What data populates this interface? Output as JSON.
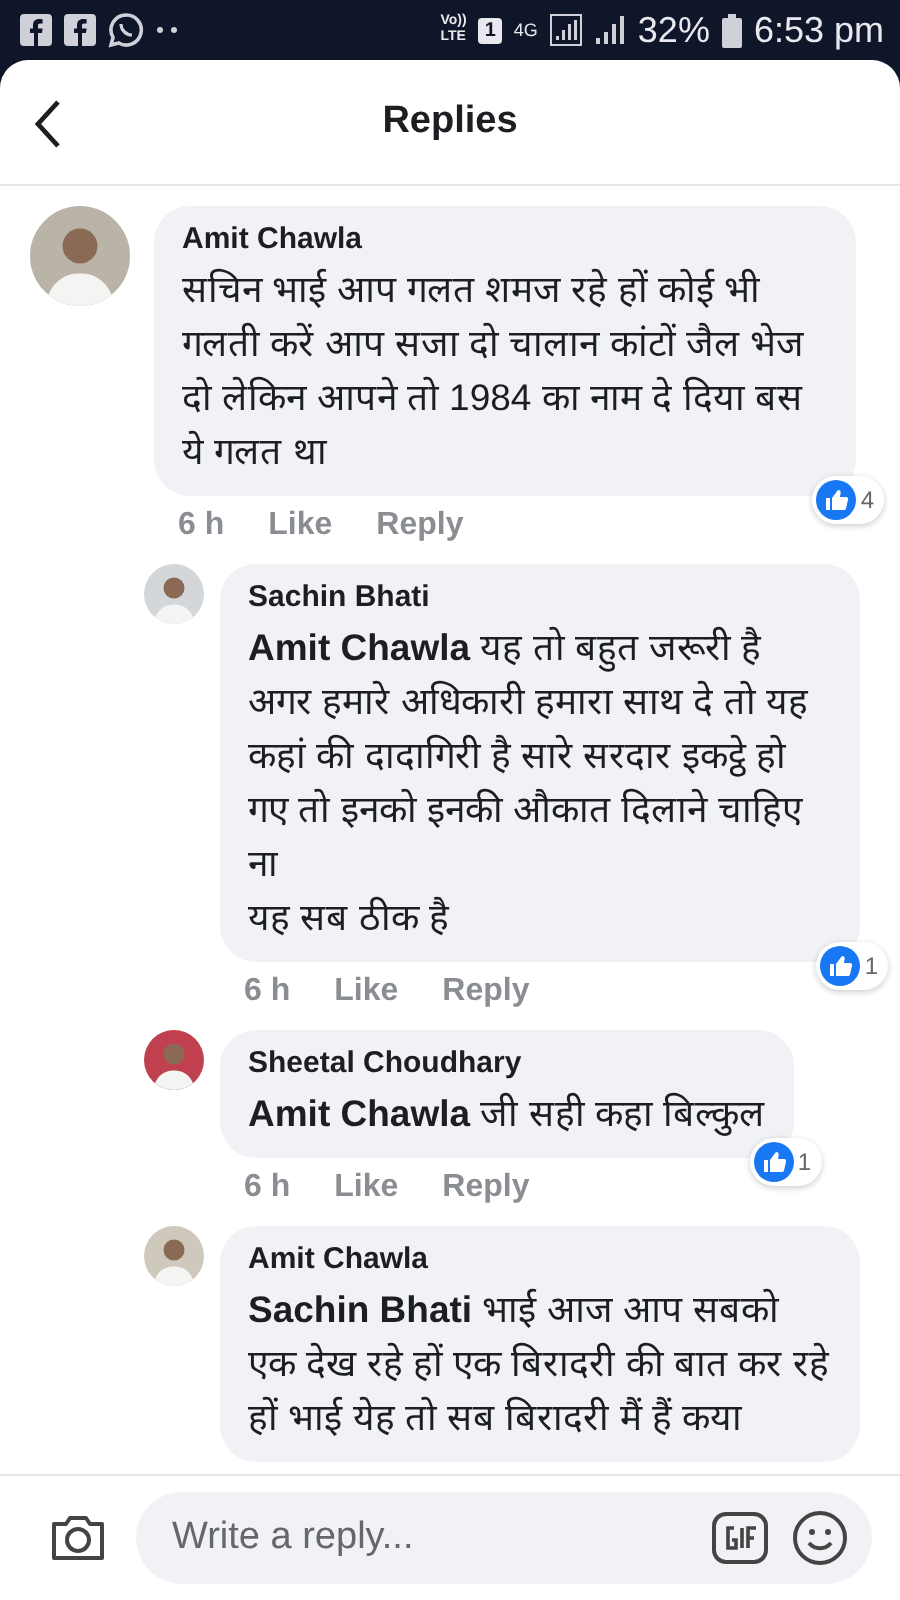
{
  "status_bar": {
    "volte": [
      "Vo))",
      "LTE"
    ],
    "sim": "1",
    "network": "4G",
    "battery": "32%",
    "time": "6:53 pm"
  },
  "header": {
    "title": "Replies"
  },
  "comments": [
    {
      "author": "Amit Chawla",
      "text": "सचिन  भाई  आप गलत शमज रहे हों कोई भी गलती करें आप सजा दो चालान कांटों जैल भेज दो लेकिन आपने तो 1984 का नाम दे दिया बस ये गलत था",
      "time": "6 h",
      "like": "Like",
      "reply": "Reply",
      "likes": "4",
      "children": [
        {
          "author": "Sachin Bhati",
          "text": "**Amit Chawla** यह तो बहुत जरूरी है अगर हमारे अधिकारी हमारा साथ दे तो यह कहां की दादागिरी है सारे सरदार इकट्ठे हो गए तो इनको इनकी औकात दिलाने चाहिए ना\nयह सब ठीक है",
          "time": "6 h",
          "like": "Like",
          "reply": "Reply",
          "likes": "1"
        },
        {
          "author": "Sheetal Choudhary",
          "text": "**Amit Chawla** जी सही कहा बिल्कुल",
          "time": "6 h",
          "like": "Like",
          "reply": "Reply",
          "likes": "1"
        },
        {
          "author": "Amit Chawla",
          "text": "**Sachin Bhati** भाई आज आप सबको एक देख रहे हों एक बिरादरी की बात कर रहे हों भाई येह तो सब बिरादरी मैं हैं कया"
        }
      ]
    }
  ],
  "composer": {
    "placeholder": "Write a reply..."
  }
}
